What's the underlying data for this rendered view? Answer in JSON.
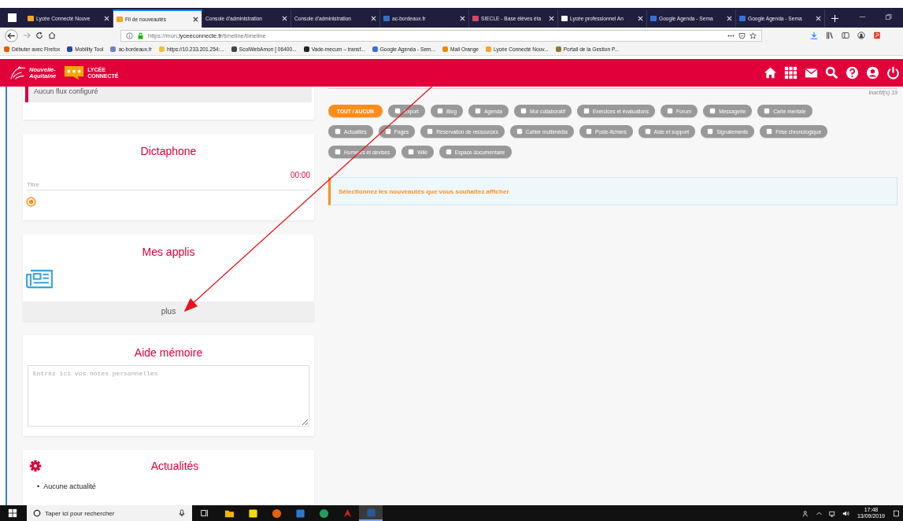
{
  "browser": {
    "tabs": [
      {
        "title": "Lycée Connecté Nouve",
        "selected": false,
        "color": "#f5a623"
      },
      {
        "title": "Fil de nouveautés",
        "selected": true,
        "color": "#f5a623"
      },
      {
        "title": "Console d'administration",
        "selected": false
      },
      {
        "title": "Console d'administration",
        "selected": false
      },
      {
        "title": "ac-bordeaux.fr",
        "selected": false,
        "color": "#3a6fc4"
      },
      {
        "title": "SIECLE - Base élèves éta",
        "selected": false,
        "color": "#d6456a"
      },
      {
        "title": "Lycée professionnel An",
        "selected": false,
        "color": "#ffffff"
      },
      {
        "title": "Google Agenda - Sema",
        "selected": false,
        "color": "#3b6fd8"
      },
      {
        "title": "Google Agenda - Sema",
        "selected": false,
        "color": "#3b6fd8"
      }
    ],
    "url": {
      "prefix": "https://mon.",
      "domain": "lyceeconnecte.fr",
      "path": "/timeline/timeline"
    },
    "bookmarks": [
      {
        "label": "Débuter avec Firefox",
        "color": "#e66000"
      },
      {
        "label": "Mobility Tool",
        "color": "#1f4aa8"
      },
      {
        "label": "ac-bordeaux.fr",
        "color": "#6a86c8"
      },
      {
        "label": "https://10.233.201.254:...",
        "color": "#f2c230"
      },
      {
        "label": "ScolWebAmon [ 06400...",
        "color": "#444444"
      },
      {
        "label": "Vade-mecum – transf...",
        "color": "#222222"
      },
      {
        "label": "Google Agenda - Sem...",
        "color": "#3b6fd8"
      },
      {
        "label": "Mail Orange",
        "color": "#f08a00"
      },
      {
        "label": "Lycée Connecté Nouv...",
        "color": "#f5a623"
      },
      {
        "label": "Portail de la Gestion P...",
        "color": "#8a7a30"
      }
    ]
  },
  "app_header": {
    "region_lines": [
      "Nouvelle-",
      "Aquitaine"
    ],
    "brand_lines": [
      "LYCÉE",
      "CONNECTÉ"
    ]
  },
  "widgets": {
    "flux": {
      "message": "Aucun flux configuré"
    },
    "dictaphone": {
      "title": "Dictaphone",
      "time": "00:00",
      "title_field": {
        "placeholder": "Titre"
      }
    },
    "apps": {
      "title": "Mes applis",
      "more": "plus"
    },
    "memo": {
      "title": "Aide mémoire",
      "notes": {
        "placeholder": "Entrez ici vos notes personnelles"
      }
    },
    "news": {
      "title": "Actualités",
      "items": [
        {
          "bullet": "•",
          "text": "Aucune actualité"
        }
      ]
    }
  },
  "timeline": {
    "inactive": "Inactif(s) 19",
    "all_toggle": {
      "label": "TOUT / AUCUN",
      "selected": true
    },
    "filters": [
      {
        "label": "Export",
        "selected": false
      },
      {
        "label": "Blog",
        "selected": false
      },
      {
        "label": "Agenda",
        "selected": false
      },
      {
        "label": "Mur collaboratif",
        "selected": false
      },
      {
        "label": "Exercices et évaluations",
        "selected": false
      },
      {
        "label": "Forum",
        "selected": false
      },
      {
        "label": "Messagerie",
        "selected": false
      },
      {
        "label": "Carte mentale",
        "selected": false
      },
      {
        "label": "Actualités",
        "selected": false
      },
      {
        "label": "Pages",
        "selected": false
      },
      {
        "label": "Réservation de ressources",
        "selected": false
      },
      {
        "label": "Cahier multimédia",
        "selected": false
      },
      {
        "label": "Poste-fichiers",
        "selected": false
      },
      {
        "label": "Aide et support",
        "selected": false
      },
      {
        "label": "Signalements",
        "selected": false
      },
      {
        "label": "Frise chronologique",
        "selected": false
      },
      {
        "label": "Humeurs et devises",
        "selected": false
      },
      {
        "label": "Wiki",
        "selected": false
      },
      {
        "label": "Espace documentaire",
        "selected": false
      }
    ],
    "notice": "Sélectionnez les nouveautés que vous souhaitez afficher"
  },
  "taskbar": {
    "search": {
      "placeholder": "Taper ici pour rechercher"
    },
    "apps": [
      {
        "kind": "folder",
        "selected": false
      },
      {
        "kind": "sticky",
        "selected": false
      },
      {
        "kind": "firefox",
        "selected": false
      },
      {
        "kind": "mail",
        "selected": false
      },
      {
        "kind": "green",
        "selected": false
      },
      {
        "kind": "acrobat",
        "selected": false
      },
      {
        "kind": "word",
        "selected": true
      }
    ],
    "time": "17:48",
    "date": "13/09/2019"
  }
}
